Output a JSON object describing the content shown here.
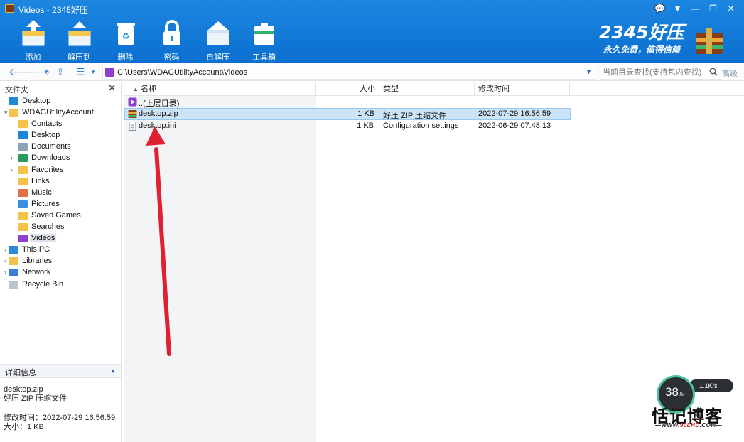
{
  "window": {
    "title": "Videos - 2345好压",
    "controls": [
      "💬",
      "▼",
      "—",
      "❐",
      "✕"
    ]
  },
  "toolbar": {
    "items": [
      {
        "label": "添加",
        "icon": "add-archive-icon"
      },
      {
        "label": "解压到",
        "icon": "extract-to-icon"
      },
      {
        "label": "删除",
        "icon": "delete-icon"
      },
      {
        "label": "密码",
        "icon": "lock-icon"
      },
      {
        "label": "自解压",
        "icon": "self-extract-icon"
      },
      {
        "label": "工具箱",
        "icon": "toolbox-icon"
      }
    ]
  },
  "brand": {
    "logo": "2345好压",
    "slogan": "永久免费，值得信赖"
  },
  "address": {
    "path": "C:\\Users\\WDAGUtilityAccount\\Videos",
    "search_placeholder": "当前目录查找(支持包内查找)",
    "advanced": "高级"
  },
  "folders_panel": {
    "title": "文件夹",
    "close": "✕",
    "tree": [
      {
        "label": "Desktop",
        "depth": 0,
        "arrow": "",
        "color": "#1e88d8"
      },
      {
        "label": "WDAGUtilityAccount",
        "depth": 0,
        "arrow": "▾",
        "color": "#f4c24a"
      },
      {
        "label": "Contacts",
        "depth": 1,
        "arrow": "",
        "color": "#f4c24a"
      },
      {
        "label": "Desktop",
        "depth": 1,
        "arrow": "",
        "color": "#1e88d8"
      },
      {
        "label": "Documents",
        "depth": 1,
        "arrow": "",
        "color": "#8ea2b8"
      },
      {
        "label": "Downloads",
        "depth": 1,
        "arrow": "›",
        "color": "#2a9a5a"
      },
      {
        "label": "Favorites",
        "depth": 1,
        "arrow": "›",
        "color": "#f4c24a"
      },
      {
        "label": "Links",
        "depth": 1,
        "arrow": "",
        "color": "#f4c24a"
      },
      {
        "label": "Music",
        "depth": 1,
        "arrow": "",
        "color": "#e0704a"
      },
      {
        "label": "Pictures",
        "depth": 1,
        "arrow": "",
        "color": "#3a8ee0"
      },
      {
        "label": "Saved Games",
        "depth": 1,
        "arrow": "",
        "color": "#f4c24a"
      },
      {
        "label": "Searches",
        "depth": 1,
        "arrow": "",
        "color": "#f4c24a"
      },
      {
        "label": "Videos",
        "depth": 1,
        "arrow": "",
        "color": "#8e3fd0",
        "selected": true
      },
      {
        "label": "This PC",
        "depth": 0,
        "arrow": "›",
        "color": "#2c8ad8"
      },
      {
        "label": "Libraries",
        "depth": 0,
        "arrow": "›",
        "color": "#f4c24a"
      },
      {
        "label": "Network",
        "depth": 0,
        "arrow": "›",
        "color": "#3a7fd0"
      },
      {
        "label": "Recycle Bin",
        "depth": 0,
        "arrow": "",
        "color": "#b8c4d0"
      }
    ]
  },
  "details": {
    "title": "详细信息",
    "file_name": "desktop.zip",
    "file_type": "好压 ZIP 压缩文件",
    "modified": "修改时间：2022-07-29 16:56:59",
    "size": "大小：1 KB"
  },
  "file_list": {
    "columns": {
      "name": "名称",
      "size": "大小",
      "type": "类型",
      "modified": "修改时间"
    },
    "rows": [
      {
        "name": "..(上层目录)",
        "size": "",
        "type": "",
        "modified": "",
        "icon": "up-folder-icon"
      },
      {
        "name": "desktop.zip",
        "size": "1 KB",
        "type": "好压 ZIP 压缩文件",
        "modified": "2022-07-29 16:56:59",
        "icon": "zip-archive-icon",
        "selected": true
      },
      {
        "name": "desktop.ini",
        "size": "1 KB",
        "type": "Configuration settings",
        "modified": "2022-06-29 07:48:13",
        "icon": "settings-file-icon"
      }
    ]
  },
  "meter": {
    "percent": "38",
    "percent_unit": "%",
    "speed": "1.1K/s"
  },
  "watermark": {
    "text": "恬记博客",
    "url_prefix": "—WWW.",
    "url_main": "90LHD",
    "url_suffix": ".COM—"
  },
  "colors": {
    "header": "#1176d6",
    "selection": "#cce4f8",
    "arrow": "#e02030"
  }
}
